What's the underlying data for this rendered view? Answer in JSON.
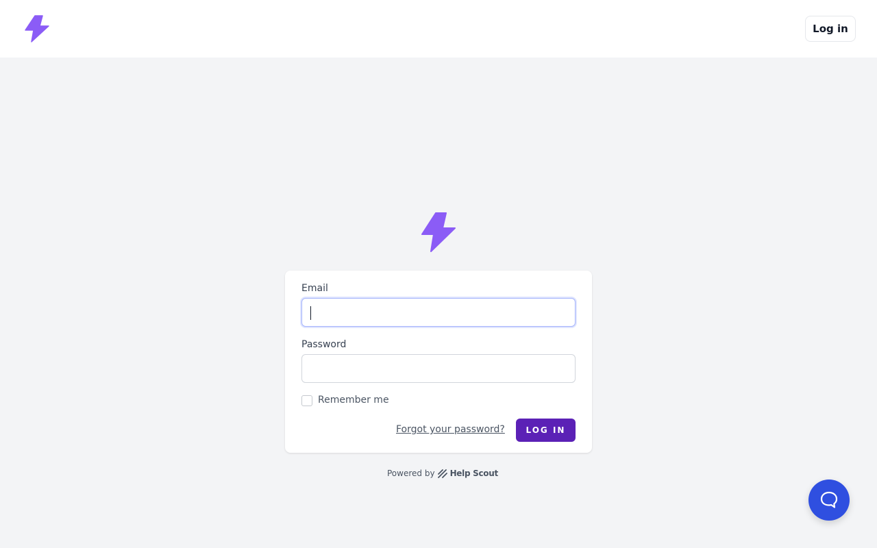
{
  "header": {
    "login_label": "Log in",
    "logo_icon": "lightning-bolt-icon"
  },
  "form": {
    "email_label": "Email",
    "email_value": "",
    "password_label": "Password",
    "password_value": "",
    "remember_label": "Remember me",
    "remember_checked": false,
    "forgot_label": "Forgot your password?",
    "submit_label": "LOG IN"
  },
  "footer": {
    "powered_prefix": "Powered by",
    "powered_brand": "Help Scout"
  },
  "beacon": {
    "icon": "chat-bubble-icon"
  },
  "colors": {
    "accent": "#5b21b6",
    "logo": "#8b5cf6",
    "beacon": "#2f4fe0",
    "background": "#f3f4f6"
  }
}
